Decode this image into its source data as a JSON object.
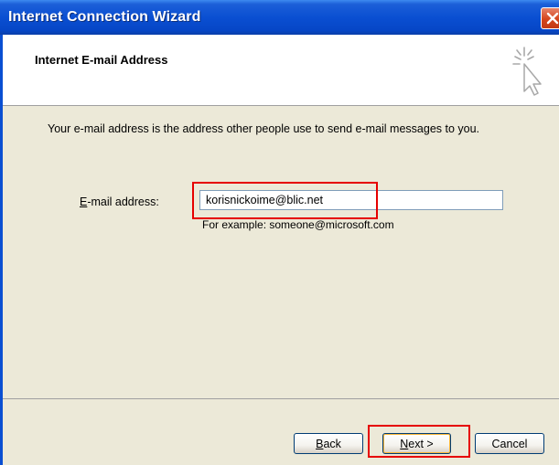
{
  "window": {
    "title": "Internet Connection Wizard"
  },
  "header": {
    "title": "Internet E-mail Address",
    "icon": "wizard-wand-cursor-icon"
  },
  "content": {
    "description": "Your e-mail address is the address other people use to send e-mail messages to you.",
    "email_label_accel": "E",
    "email_label_rest": "-mail address:",
    "email_value": "korisnickoime@blic.net",
    "example": "For example: someone@microsoft.com"
  },
  "footer": {
    "back_accel": "B",
    "back_rest": "ack",
    "next_accel": "N",
    "next_rest": "ext >",
    "cancel": "Cancel"
  },
  "annotations": {
    "highlight_color": "#e60000"
  }
}
